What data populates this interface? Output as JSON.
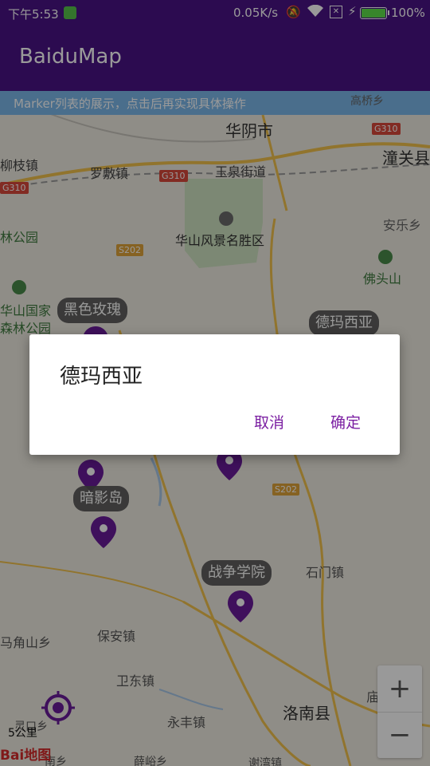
{
  "status_bar": {
    "time": "下午5:53",
    "network_speed": "0.05K/s",
    "battery": "100%",
    "icons": [
      "notification-app-icon",
      "mute-icon",
      "wifi-icon",
      "sim-icon",
      "charging-icon",
      "battery-icon"
    ]
  },
  "app_bar": {
    "title": "BaiduMap"
  },
  "map": {
    "banner": "Marker列表的展示，点击后再实现具体操作",
    "places": {
      "huayin": "华阴市",
      "tongguan": "潼关县",
      "gaoqiao": "高桥乡",
      "liuzhi": "柳枝镇",
      "luofu": "罗敷镇",
      "yuquan": "玉泉街道",
      "huashan_scenic": "华山风景名胜区",
      "anle": "安乐乡",
      "linpark": "林公园",
      "futoushan": "佛头山",
      "huashan_national": "华山国家",
      "forest_park": "森林公园",
      "shimen": "石门镇",
      "majiaoshan": "马角山乡",
      "baoan": "保安镇",
      "weidong": "卫东镇",
      "luonan": "洛南县",
      "yongfeng": "永丰镇",
      "miao": "庙",
      "xiyu": "薛峪乡",
      "lingkou": "灵口乡",
      "nanxiang": "南乡",
      "xieyuan": "谢湾镇"
    },
    "roads": {
      "g310_a": "G310",
      "g310_b": "G310",
      "g310_c": "G310",
      "s202_a": "S202",
      "s202_b": "S202"
    },
    "markers": [
      {
        "label": "黑色玫瑰"
      },
      {
        "label": "德玛西亚"
      },
      {
        "label": "暗影岛"
      },
      {
        "label": "战争学院"
      }
    ],
    "scale": "5公里",
    "logo": "Bai地图",
    "zoom": {
      "plus": "+",
      "minus": "−"
    },
    "accent_color": "#6a1b9a"
  },
  "dialog": {
    "message": "德玛西亚",
    "cancel": "取消",
    "ok": "确定"
  }
}
